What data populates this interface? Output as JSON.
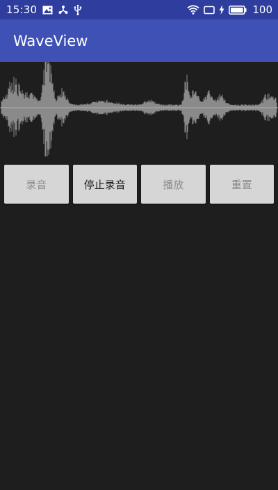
{
  "status_bar": {
    "time": "15:30",
    "battery_level": "100",
    "left_icons": [
      "image-icon",
      "usb-tether-icon",
      "usb-icon"
    ],
    "right_icons": [
      "wifi-icon",
      "cast-icon",
      "charging-icon",
      "battery-icon"
    ]
  },
  "app_bar": {
    "title": "WaveView",
    "color": "#3f51b5"
  },
  "buttons": {
    "record": {
      "label": "录音",
      "enabled": false
    },
    "stop_record": {
      "label": "停止录音",
      "enabled": true
    },
    "play": {
      "label": "播放",
      "enabled": false
    },
    "reset": {
      "label": "重置",
      "enabled": false
    }
  },
  "colors": {
    "background": "#1e1e1e",
    "wave": "#8a8a8a",
    "button_bg": "#d6d6d6"
  }
}
